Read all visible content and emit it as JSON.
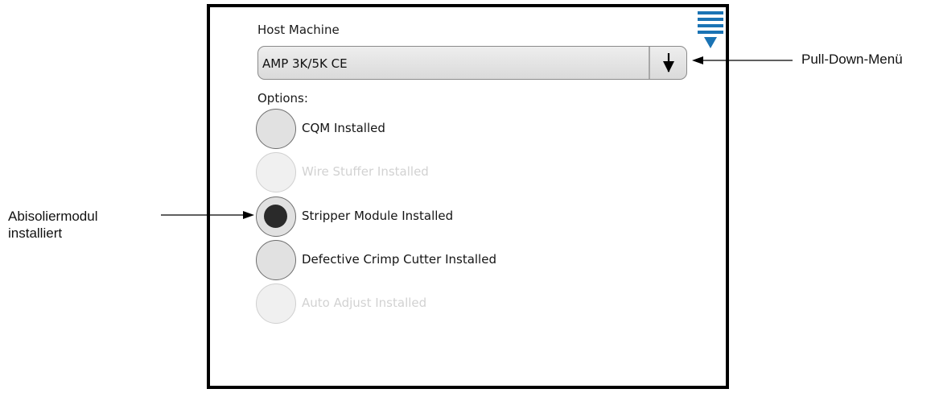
{
  "screen": {
    "host_machine_label": "Host Machine",
    "dropdown_value": "AMP 3K/5K CE",
    "options_label": "Options:",
    "menu_icon": "menu-icon",
    "dropdown_icon": "arrow-down-icon",
    "accent_color": "#1a73b4",
    "options": [
      {
        "label": "CQM Installed",
        "selected": false,
        "enabled": true
      },
      {
        "label": "Wire Stuffer Installed",
        "selected": false,
        "enabled": false
      },
      {
        "label": "Stripper Module Installed",
        "selected": true,
        "enabled": true
      },
      {
        "label": "Defective Crimp Cutter Installed",
        "selected": false,
        "enabled": true
      },
      {
        "label": "Auto Adjust Installed",
        "selected": false,
        "enabled": false
      }
    ]
  },
  "callouts": {
    "pulldown": "Pull-Down-Menü",
    "stripper_line1": "Abisoliermodul",
    "stripper_line2": "installiert"
  }
}
